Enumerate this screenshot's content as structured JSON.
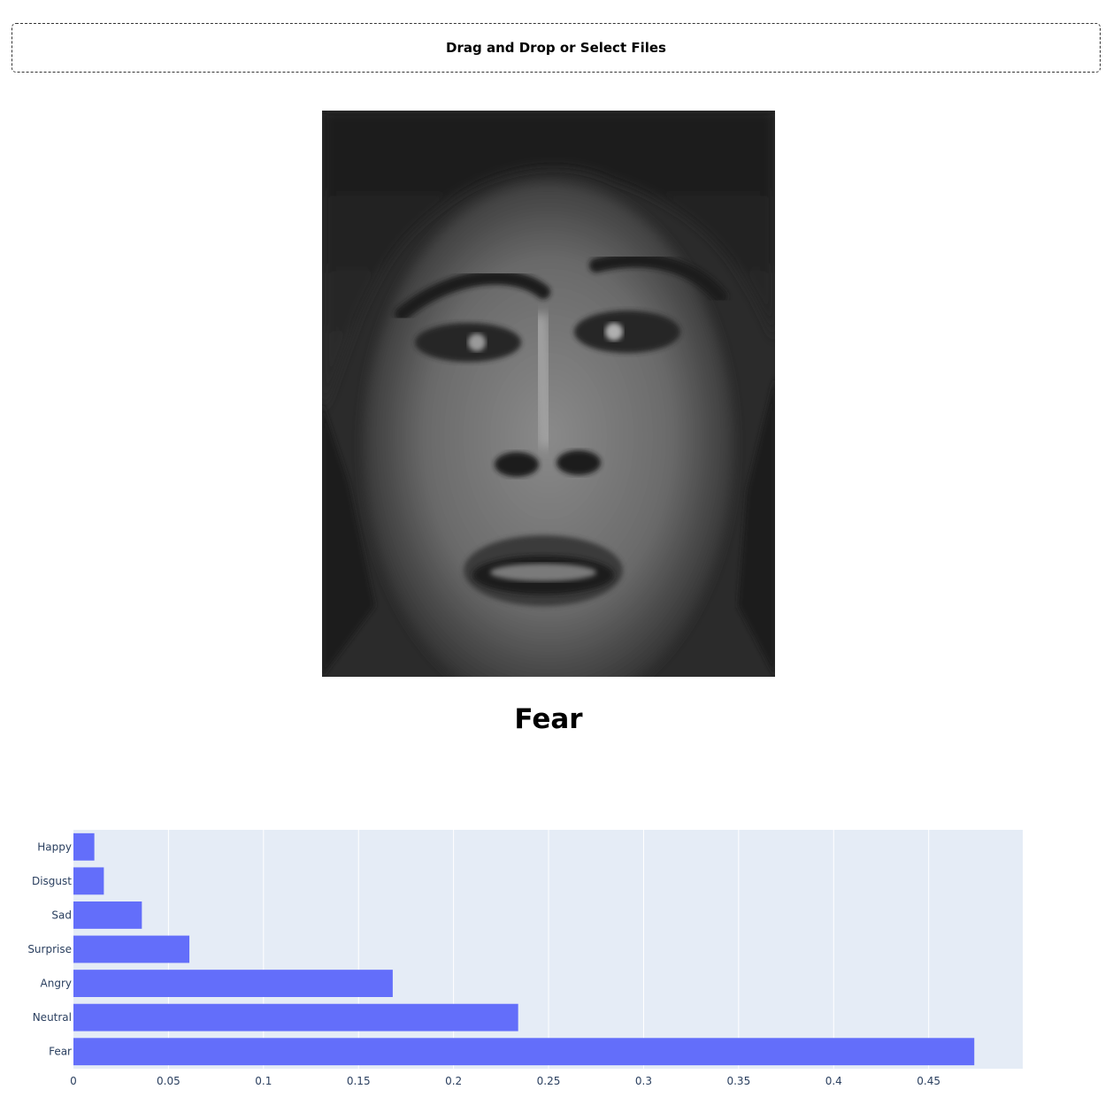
{
  "upload": {
    "label": "Drag and Drop or Select Files"
  },
  "image": {
    "alt": "uploaded face image (grayscale)"
  },
  "prediction": {
    "label": "Fear"
  },
  "colors": {
    "bar": "#636efa",
    "plot_bg": "#e5ecf6",
    "grid": "#ffffff",
    "tick_text": "#2a3f5f"
  },
  "chart_data": {
    "type": "bar",
    "orientation": "horizontal",
    "categories": [
      "Happy",
      "Disgust",
      "Sad",
      "Surprise",
      "Angry",
      "Neutral",
      "Fear"
    ],
    "values": [
      0.011,
      0.016,
      0.036,
      0.061,
      0.168,
      0.234,
      0.474
    ],
    "xlim": [
      0,
      0.4995
    ],
    "xticks": [
      0,
      0.05,
      0.1,
      0.15,
      0.2,
      0.25,
      0.3,
      0.35,
      0.4,
      0.45
    ],
    "xtick_labels": [
      "0",
      "0.05",
      "0.1",
      "0.15",
      "0.2",
      "0.25",
      "0.3",
      "0.35",
      "0.4",
      "0.45"
    ],
    "title": "",
    "xlabel": "",
    "ylabel": "",
    "grid": true
  }
}
